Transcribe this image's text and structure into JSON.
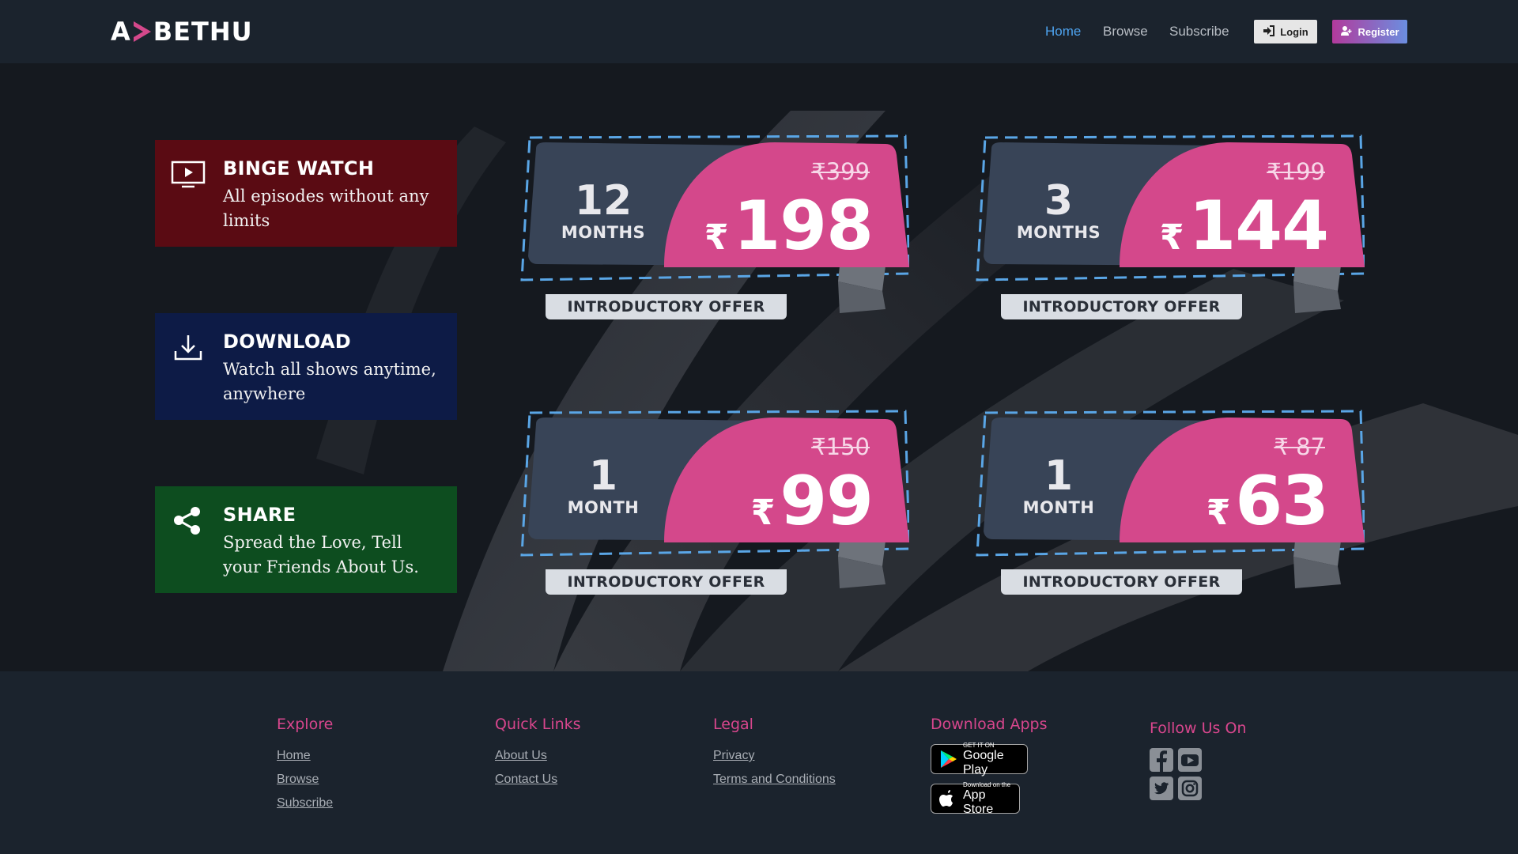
{
  "header": {
    "logo_text": "ABETHU",
    "nav": {
      "home": "Home",
      "browse": "Browse",
      "subscribe": "Subscribe"
    },
    "login_label": "Login",
    "register_label": "Register"
  },
  "features": [
    {
      "title": "BINGE WATCH",
      "text": "All episodes without any limits",
      "icon": "tv-play-icon"
    },
    {
      "title": "DOWNLOAD",
      "text": "Watch all shows anytime, anywhere",
      "icon": "download-icon"
    },
    {
      "title": "SHARE",
      "text": "Spread the Love, Tell your Friends About Us.",
      "icon": "share-icon"
    }
  ],
  "plans": [
    {
      "duration": "12",
      "unit": "MONTHS",
      "old_price": "₹399",
      "currency": "₹",
      "price": "198",
      "ribbon": "INTRODUCTORY OFFER"
    },
    {
      "duration": "3",
      "unit": "MONTHS",
      "old_price": "₹199",
      "currency": "₹",
      "price": "144",
      "ribbon": "INTRODUCTORY OFFER"
    },
    {
      "duration": "1",
      "unit": "MONTH",
      "old_price": "₹150",
      "currency": "₹",
      "price": "99",
      "ribbon": "INTRODUCTORY OFFER"
    },
    {
      "duration": "1",
      "unit": "MONTH",
      "old_price": "₹ 87",
      "currency": "₹",
      "price": "63",
      "ribbon": "INTRODUCTORY OFFER"
    }
  ],
  "colors": {
    "accent_pink": "#d4488b",
    "card_slate": "#384457",
    "dash_blue": "#5aa6e6",
    "nav_active": "#4ea3ef"
  },
  "footer": {
    "explore": {
      "title": "Explore",
      "links": [
        "Home",
        "Browse",
        "Subscribe"
      ]
    },
    "quick_links": {
      "title": "Quick Links",
      "links": [
        "About Us",
        "Contact Us"
      ]
    },
    "legal": {
      "title": "Legal",
      "links": [
        "Privacy",
        "Terms and Conditions"
      ]
    },
    "apps": {
      "title": "Download Apps",
      "google_small": "GET IT ON",
      "google_big": "Google Play",
      "apple_small": "Download on the",
      "apple_big": "App Store"
    },
    "follow": {
      "title": "Follow Us On",
      "icons": [
        "facebook-icon",
        "youtube-icon",
        "twitter-icon",
        "instagram-icon"
      ]
    }
  }
}
